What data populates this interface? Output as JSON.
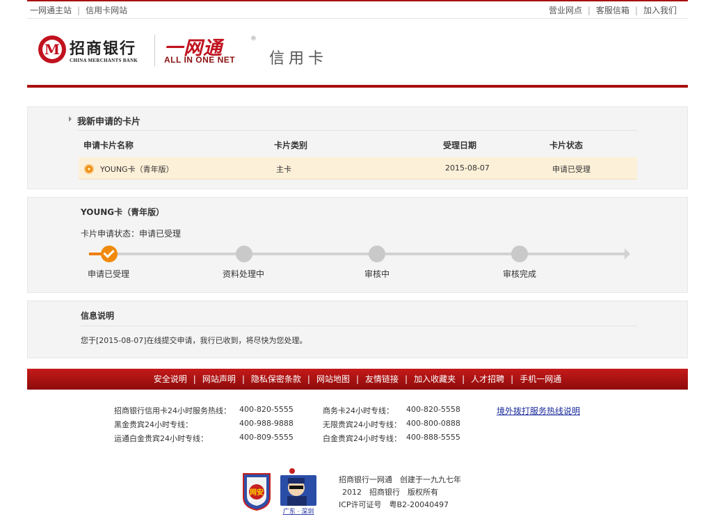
{
  "topbar": {
    "left_links": [
      "一网通主站",
      "信用卡网站"
    ],
    "right_links": [
      "营业网点",
      "客服信箱",
      "加入我们"
    ]
  },
  "logo": {
    "bank_mark": "M",
    "bank_name": "招商银行",
    "bank_name_en": "CHINA MERCHANTS BANK",
    "ywt_cn": "一网通",
    "ywt_en": "ALL IN ONE NET",
    "reg": "®",
    "section": "信用卡"
  },
  "new_cards": {
    "title": "我新申请的卡片",
    "headers": [
      "申请卡片名称",
      "卡片类别",
      "受理日期",
      "卡片状态"
    ],
    "rows": [
      {
        "name": "YOUNG卡（青年版）",
        "type": "主卡",
        "date": "2015-08-07",
        "status": "申请已受理"
      }
    ]
  },
  "progress": {
    "card_title": "YOUNG卡（青年版）",
    "status_label": "卡片申请状态：",
    "status_value": "申请已受理",
    "steps": [
      "申请已受理",
      "资料处理中",
      "审核中",
      "审核完成"
    ],
    "current_step": 1,
    "accent_color": "#f08a0c"
  },
  "info": {
    "title": "信息说明",
    "text": "您于[2015-08-07]在线提交申请，我行已收到，将尽快为您处理。"
  },
  "footer_nav": [
    "安全说明",
    "网站声明",
    "隐私保密条款",
    "网站地图",
    "友情链接",
    "加入收藏夹",
    "人才招聘",
    "手机一网通"
  ],
  "hotlines": {
    "col1": [
      {
        "label": "招商银行信用卡24小时服务热线：",
        "number": "400-820-5555"
      },
      {
        "label": "黑金贵宾24小时专线：",
        "number": "400-988-9888"
      },
      {
        "label": "运通白金贵宾24小时专线：",
        "number": "400-809-5555"
      }
    ],
    "col2": [
      {
        "label": "商务卡24小时专线：",
        "number": "400-820-5558"
      },
      {
        "label": "无限贵宾24小时专线：",
        "number": "400-800-0888"
      },
      {
        "label": "白金贵宾24小时专线：",
        "number": "400-888-5555"
      }
    ],
    "overseas_link": "境外拨打服务热线说明"
  },
  "badges": {
    "badge1_text": "网安",
    "badge2_caption": "广东 · 深圳"
  },
  "copyright": {
    "line1": "招商银行一网通　创建于一九九七年",
    "line2": "2012　招商银行　版权所有",
    "line3": "ICP许可证号　粤B2-20040497"
  },
  "colors": {
    "brand_red": "#a90e0e",
    "highlight_row": "#fdf0d8"
  }
}
